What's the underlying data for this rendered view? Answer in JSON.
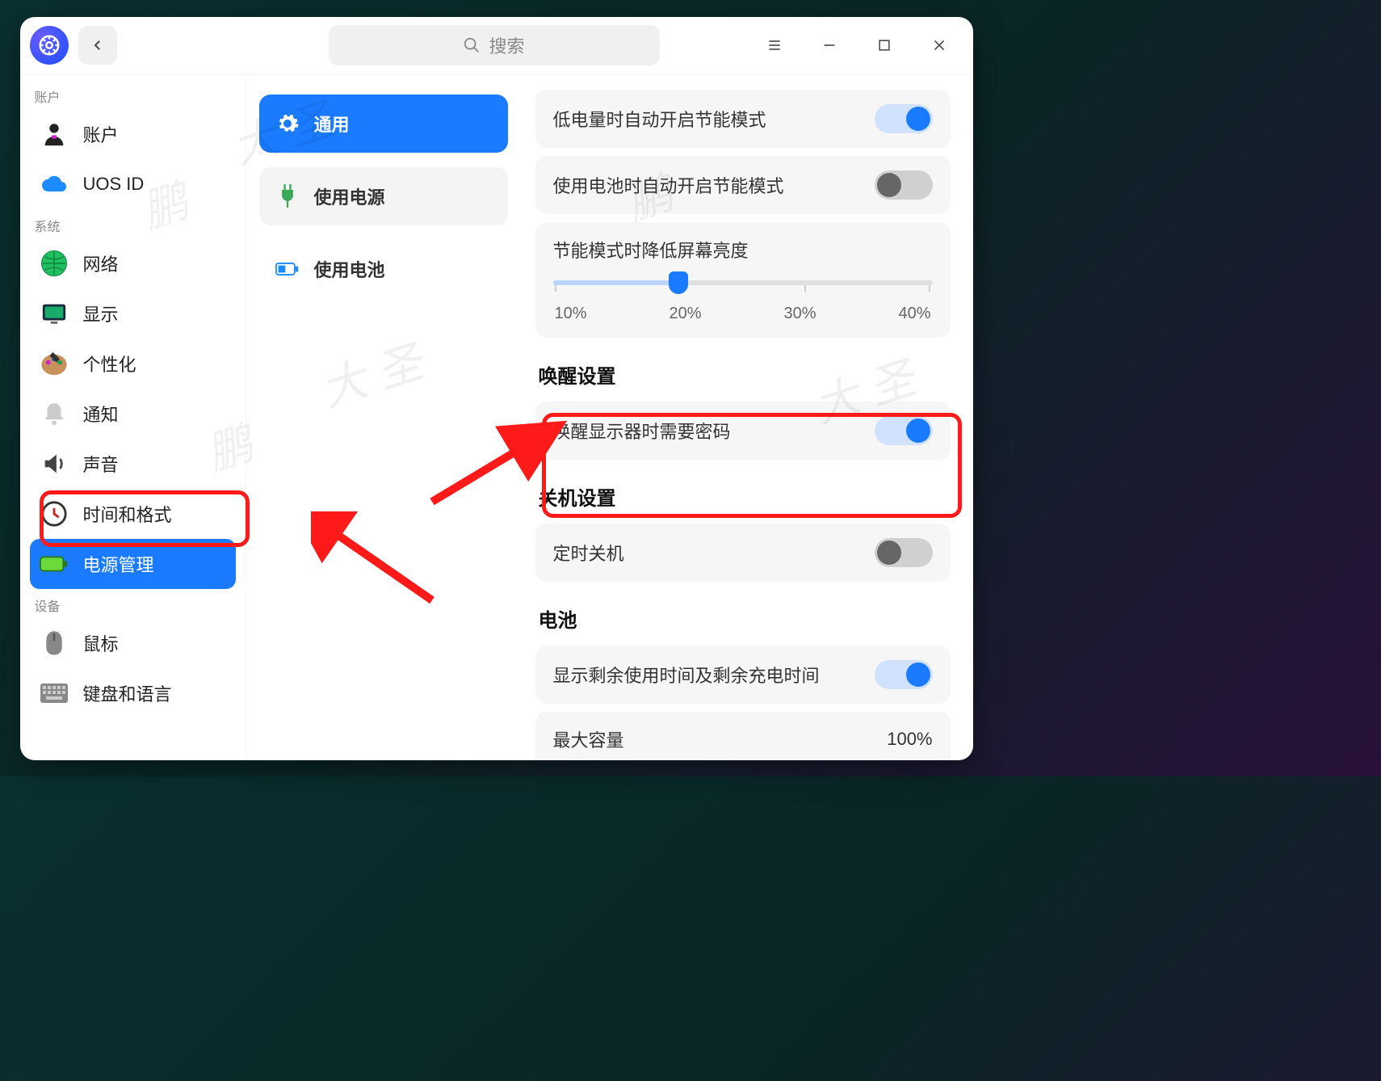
{
  "search": {
    "placeholder": "搜索"
  },
  "sidebar": {
    "groups": [
      {
        "label": "账户"
      },
      {
        "label": "系统"
      },
      {
        "label": "设备"
      }
    ],
    "items": {
      "account": "账户",
      "uosid": "UOS ID",
      "network": "网络",
      "display": "显示",
      "personalize": "个性化",
      "notify": "通知",
      "sound": "声音",
      "timefmt": "时间和格式",
      "power": "电源管理",
      "mouse": "鼠标",
      "keyboard": "键盘和语言"
    }
  },
  "subnav": {
    "general": "通用",
    "on_power": "使用电源",
    "on_battery": "使用电池"
  },
  "content": {
    "low_battery_eco": "低电量时自动开启节能模式",
    "on_battery_eco": "使用电池时自动开启节能模式",
    "eco_brightness": "节能模式时降低屏幕亮度",
    "brightness_ticks": [
      "10%",
      "20%",
      "30%",
      "40%"
    ],
    "brightness_value_pct": 33,
    "wake_section": "唤醒设置",
    "wake_need_pwd": "唤醒显示器时需要密码",
    "shutdown_section": "关机设置",
    "scheduled_shutdown": "定时关机",
    "battery_section": "电池",
    "show_remain": "显示剩余使用时间及剩余充电时间",
    "max_capacity": "最大容量",
    "max_capacity_value": "100%"
  },
  "watermarks": [
    "大 圣",
    "鹏",
    "大 圣",
    "鹏",
    "大 圣",
    "鹏"
  ]
}
